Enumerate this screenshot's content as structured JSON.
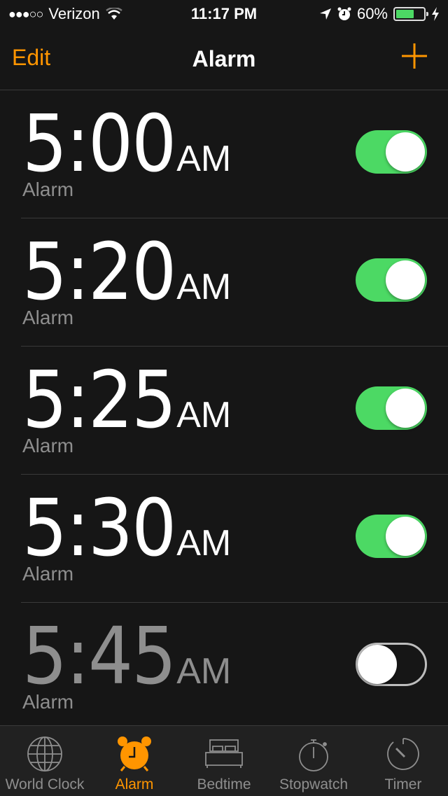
{
  "status_bar": {
    "signal_dots": "●●●○○",
    "carrier": "Verizon",
    "time": "11:17 PM",
    "battery_percent": "60%",
    "battery_level": 0.6,
    "icons": [
      "wifi-icon",
      "location-icon",
      "alarm-icon",
      "battery-icon",
      "charging-icon"
    ]
  },
  "navbar": {
    "edit_label": "Edit",
    "title": "Alarm",
    "add_icon": "plus-icon"
  },
  "colors": {
    "accent": "#ff9500",
    "toggle_on": "#4cd964",
    "background": "#161616",
    "secondary_text": "#8e8e8e"
  },
  "alarms": [
    {
      "time": "5:00",
      "period": "AM",
      "label": "Alarm",
      "enabled": true
    },
    {
      "time": "5:20",
      "period": "AM",
      "label": "Alarm",
      "enabled": true
    },
    {
      "time": "5:25",
      "period": "AM",
      "label": "Alarm",
      "enabled": true
    },
    {
      "time": "5:30",
      "period": "AM",
      "label": "Alarm",
      "enabled": true
    },
    {
      "time": "5:45",
      "period": "AM",
      "label": "Alarm",
      "enabled": false
    }
  ],
  "tabs": [
    {
      "label": "World Clock",
      "icon": "globe-icon",
      "active": false
    },
    {
      "label": "Alarm",
      "icon": "alarm-clock-icon",
      "active": true
    },
    {
      "label": "Bedtime",
      "icon": "bed-icon",
      "active": false
    },
    {
      "label": "Stopwatch",
      "icon": "stopwatch-icon",
      "active": false
    },
    {
      "label": "Timer",
      "icon": "timer-icon",
      "active": false
    }
  ]
}
